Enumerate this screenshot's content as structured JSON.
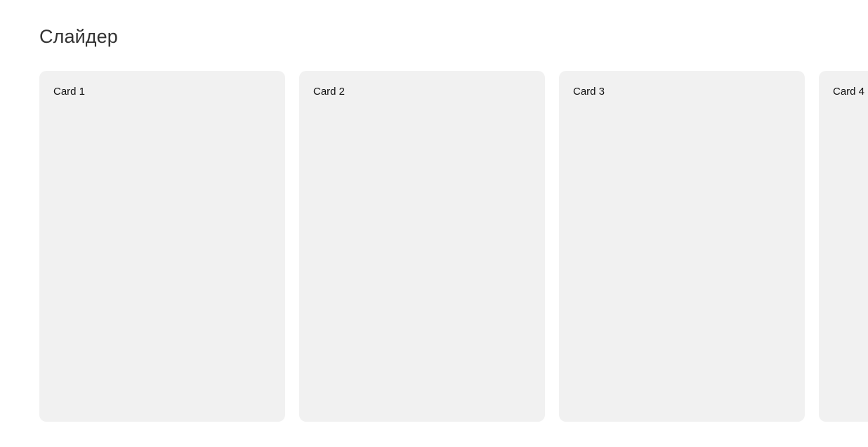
{
  "page": {
    "title": "Слайдер"
  },
  "slider": {
    "cards": [
      {
        "label": "Card 1"
      },
      {
        "label": "Card 2"
      },
      {
        "label": "Card 3"
      },
      {
        "label": "Card 4"
      }
    ]
  },
  "colors": {
    "title": "#333333",
    "card_background": "#f1f1f1",
    "card_text": "#111111",
    "page_background": "#ffffff"
  }
}
